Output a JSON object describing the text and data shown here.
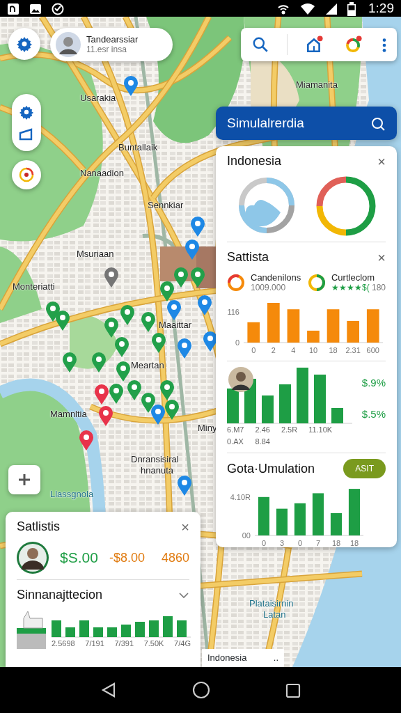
{
  "status_bar": {
    "time": "1:29"
  },
  "profile": {
    "name": "Tandearssiar",
    "subtitle": "11.esr insa"
  },
  "toolbar": [
    {
      "kind": "search",
      "badge": false
    },
    {
      "kind": "home",
      "badge": true
    },
    {
      "kind": "ring",
      "badge": true
    },
    {
      "kind": "more",
      "badge": false
    }
  ],
  "map": {
    "labels": [
      "Miamanita",
      "Usarakia",
      "Buntallaik",
      "Nanaadion",
      "Sennkiar",
      "Msuriaan",
      "Monteriatti",
      "Maaittar",
      "Meartan",
      "Mamnltia",
      "Miny",
      "Dnransisiral",
      "hnanuta",
      "Llassgnola",
      "Plataisirnin",
      "Latan"
    ],
    "pins": [
      {
        "color": "#1e88e5"
      },
      {
        "color": "#1e88e5"
      },
      {
        "color": "#1e88e5"
      },
      {
        "color": "#757575"
      },
      {
        "color": "#22a04a"
      },
      {
        "color": "#22a04a"
      },
      {
        "color": "#22a04a"
      },
      {
        "color": "#1e88e5"
      },
      {
        "color": "#1e88e5"
      },
      {
        "color": "#22a04a"
      },
      {
        "color": "#22a04a"
      },
      {
        "color": "#22a04a"
      },
      {
        "color": "#22a04a"
      },
      {
        "color": "#22a04a"
      },
      {
        "color": "#1e88e5"
      },
      {
        "color": "#1e88e5"
      },
      {
        "color": "#22a04a"
      },
      {
        "color": "#22a04a"
      },
      {
        "color": "#22a04a"
      },
      {
        "color": "#22a04a"
      },
      {
        "color": "#22a04a"
      },
      {
        "color": "#e8334a"
      },
      {
        "color": "#e8334a"
      },
      {
        "color": "#e8334a"
      },
      {
        "color": "#22a04a"
      },
      {
        "color": "#22a04a"
      },
      {
        "color": "#22a04a"
      },
      {
        "color": "#22a04a"
      },
      {
        "color": "#22a04a"
      },
      {
        "color": "#1e88e5"
      },
      {
        "color": "#1e88e5"
      }
    ]
  },
  "search_panel": {
    "title": "Simulalrerdia"
  },
  "indonesia_card": {
    "title": "Indonesia",
    "close": "×"
  },
  "stats_card": {
    "title": "Sattista",
    "close": "×",
    "legend": [
      {
        "name": "Candenilons",
        "value": "1009.000",
        "kind": "plain"
      },
      {
        "name": "Curtleclom",
        "rating": "★★★★$(",
        "value": "180",
        "kind": "rated"
      }
    ],
    "chart_data": {
      "type": "bar",
      "categories": [
        "0",
        "2",
        "4",
        "10",
        "18",
        "2.31",
        "600"
      ],
      "series": [
        {
          "color": "#f58a0b",
          "values": [
            77,
            150,
            126,
            45,
            126,
            82,
            126
          ]
        }
      ],
      "ylim": [
        0,
        158
      ],
      "yticks": [
        0,
        {
          "value": 116,
          "label": "116"
        }
      ]
    },
    "comparison": {
      "labels": [
        "6.M7",
        "2.46",
        "2.5R",
        "11.10K"
      ],
      "sublabels": [
        "0.AX",
        "8.84"
      ],
      "values": [
        "$.9%",
        "$.5%"
      ]
    }
  },
  "simulation": {
    "title": "Gota·Umulation",
    "button": "ASIT",
    "chart_data": {
      "type": "bar",
      "categories": [
        "0",
        "3",
        "0",
        "7",
        "18",
        "18"
      ],
      "series": [
        {
          "color": "#1e9e45",
          "values": [
            4.1,
            2.85,
            3.43,
            4.5,
            2.38,
            4.97
          ]
        }
      ],
      "ylim": [
        0,
        5.2
      ],
      "yticks": [
        {
          "value": 0,
          "label": "00"
        },
        {
          "value": 4.1,
          "label": "4.10R"
        }
      ]
    }
  },
  "bottom_card": {
    "title": "Satlistis",
    "close": "×",
    "amounts": [
      {
        "text": "$S.00",
        "kind": "gain"
      },
      {
        "text": "-$8.00",
        "kind": "loss"
      },
      {
        "text": "4860",
        "kind": "loss"
      }
    ],
    "section": {
      "title": "Sinnanajttecion",
      "expanded": false,
      "labels": [
        "2.5698",
        "7/191",
        "7/391",
        "7.50K",
        "7/4G"
      ]
    }
  },
  "map_chip": {
    "label": "Indonesia",
    "more": ".."
  }
}
